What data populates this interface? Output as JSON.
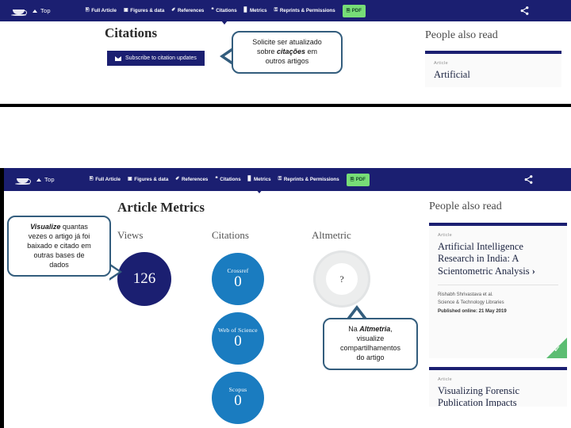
{
  "nav": {
    "logo_name": "taylor-francis-cup-logo",
    "top_label": "Top",
    "items": [
      {
        "label": "Full Article",
        "glyph": "὜E",
        "icon": "document-icon",
        "active": false
      },
      {
        "label": "Figures & data",
        "glyph": "▣",
        "icon": "figures-icon",
        "active": false
      },
      {
        "label": "References",
        "glyph": "✐",
        "icon": "references-icon",
        "active": false
      },
      {
        "label": "Citations",
        "glyph": "❝",
        "icon": "citations-icon",
        "active": true
      },
      {
        "label": "Metrics",
        "glyph": "█",
        "icon": "metrics-icon",
        "active": false
      },
      {
        "label": "Reprints & Permissions",
        "glyph": "⚿",
        "icon": "reprints-icon",
        "active": false
      }
    ],
    "pdf_label": "PDF",
    "pdf_color": "#77dd77",
    "share_icon": "share-nodes-icon",
    "bar_color": "#1b1f71"
  },
  "panel_top": {
    "heading": "Citations",
    "subscribe_label": "Subscribe to citation updates",
    "callout": {
      "line1": "Solicite ser atualizado",
      "line2_pre": "sobre ",
      "line2_em": "citações",
      "line2_post": " em",
      "line3": "outros artigos"
    },
    "rail_title": "People also read",
    "card": {
      "kicker": "Article",
      "title": "Artificial"
    }
  },
  "panel_bottom": {
    "heading": "Article Metrics",
    "callout_left": {
      "line1_em": "Visualize",
      "line1_post": " quantas",
      "line2": "vezes o artigo já foi",
      "line3": "baixado e citado em",
      "line4": "outras bases de",
      "line5": "dados"
    },
    "callout_altmetric": {
      "line1_pre": "Na ",
      "line1_em": "Altmetria",
      "line1_post": ",",
      "line2": "visualize",
      "line3": "compartilhamentos",
      "line4": "do artigo"
    },
    "views": {
      "label": "Views",
      "value": "126",
      "color": "#1b1f71"
    },
    "citations": {
      "label": "Citations",
      "color": "#1a7cc0",
      "sources": [
        {
          "name": "Crossref",
          "value": "0"
        },
        {
          "name": "Web of Science",
          "value": "0"
        },
        {
          "name": "Scopus",
          "value": "0"
        }
      ]
    },
    "altmetric": {
      "label": "Altmetric",
      "value": "?"
    },
    "rail_title": "People also read",
    "cards": [
      {
        "kicker": "Article",
        "title": "Artificial Intelligence Research in India: A Scientometric Analysis",
        "arrow": "›",
        "authors": "Rishabh Shrivastava et al.",
        "journal": "Science & Technology Libraries",
        "published": "Published online: 21 May 2019",
        "badge": "✓"
      },
      {
        "kicker": "Article",
        "title": "Visualizing Forensic Publication Impacts"
      }
    ]
  }
}
